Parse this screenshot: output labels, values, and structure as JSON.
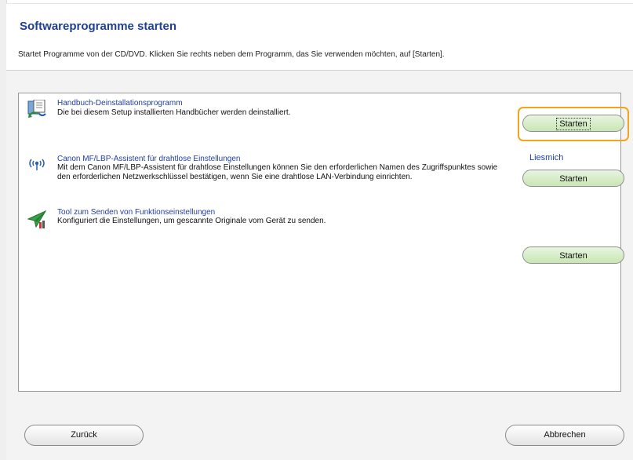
{
  "header": {
    "title": "Softwareprogramme starten",
    "subtitle": "Startet Programme von der CD/DVD. Klicken Sie rechts neben dem Programm, das Sie verwenden möchten, auf [Starten]."
  },
  "programs": [
    {
      "title": "Handbuch-Deinstallationsprogramm",
      "description": "Die bei diesem Setup installierten Handbücher werden deinstalliert.",
      "icon": "uninstall-manual-icon",
      "start_label": "Starten",
      "focused": true
    },
    {
      "title": "Canon MF/LBP-Assistent für drahtlose Einstellungen",
      "description": "Mit dem Canon MF/LBP-Assistent für drahtlose Einstellungen können Sie den erforderlichen Namen des Zugriffspunktes sowie den erforderlichen Netzwerkschlüssel bestätigen, wenn Sie eine drahtlose LAN-Verbindung einrichten.",
      "icon": "wireless-antenna-icon",
      "readme_label": "Liesmich",
      "start_label": "Starten"
    },
    {
      "title": "Tool zum Senden von Funktionseinstellungen",
      "description": "Konfiguriert die Einstellungen, um gescannte Originale vom Gerät zu senden.",
      "icon": "send-function-tool-icon",
      "start_label": "Starten"
    }
  ],
  "footer": {
    "back_label": "Zurück",
    "cancel_label": "Abbrechen"
  },
  "colors": {
    "title": "#1f3f8f",
    "link": "#1f3fa3",
    "highlight": "#f2a41c",
    "start_button": "#c8e6b3"
  }
}
